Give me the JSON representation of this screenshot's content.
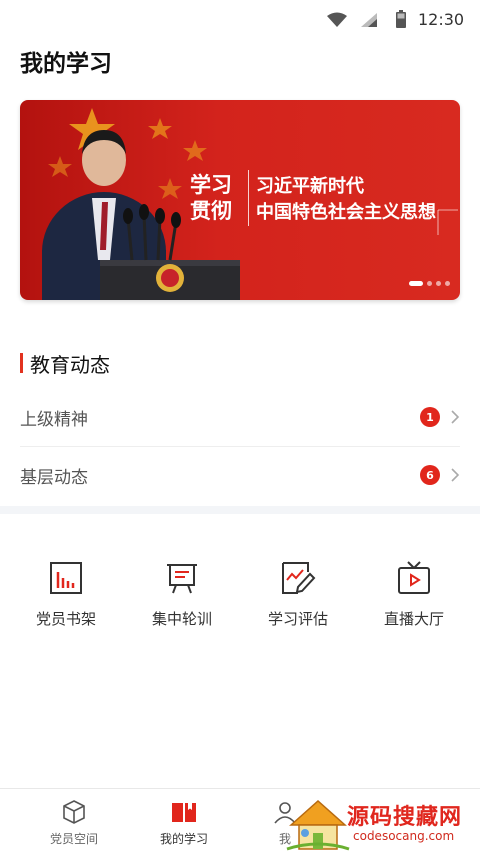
{
  "status_bar": {
    "time": "12:30",
    "icons": [
      "wifi-icon",
      "signal-icon",
      "battery-icon"
    ]
  },
  "page_title": "我的学习",
  "banner": {
    "title_main": "学习贯彻",
    "subtitle_line1": "习近平新时代",
    "subtitle_line2": "中国特色社会主义思想",
    "active_slide": 1,
    "slide_count": 4
  },
  "education": {
    "section_title": "教育动态",
    "items": [
      {
        "label": "上级精神",
        "badge": "1"
      },
      {
        "label": "基层动态",
        "badge": "6"
      }
    ]
  },
  "features": [
    {
      "label": "党员书架",
      "icon": "bookshelf-chart-icon"
    },
    {
      "label": "集中轮训",
      "icon": "training-board-icon"
    },
    {
      "label": "学习评估",
      "icon": "evaluation-pen-icon"
    },
    {
      "label": "直播大厅",
      "icon": "live-tv-icon"
    }
  ],
  "tabbar": {
    "tabs": [
      {
        "label": "党员空间",
        "icon": "cube-icon",
        "active": false
      },
      {
        "label": "我的学习",
        "icon": "book-icon",
        "active": true
      },
      {
        "label": "我",
        "icon": "person-icon",
        "active": false
      }
    ]
  },
  "watermark": {
    "text": "源码搜藏网",
    "url": "codesocang.com"
  },
  "colors": {
    "accent": "#e1261c",
    "banner_red": "#d3231c",
    "text": "#222222",
    "muted": "#555555"
  }
}
